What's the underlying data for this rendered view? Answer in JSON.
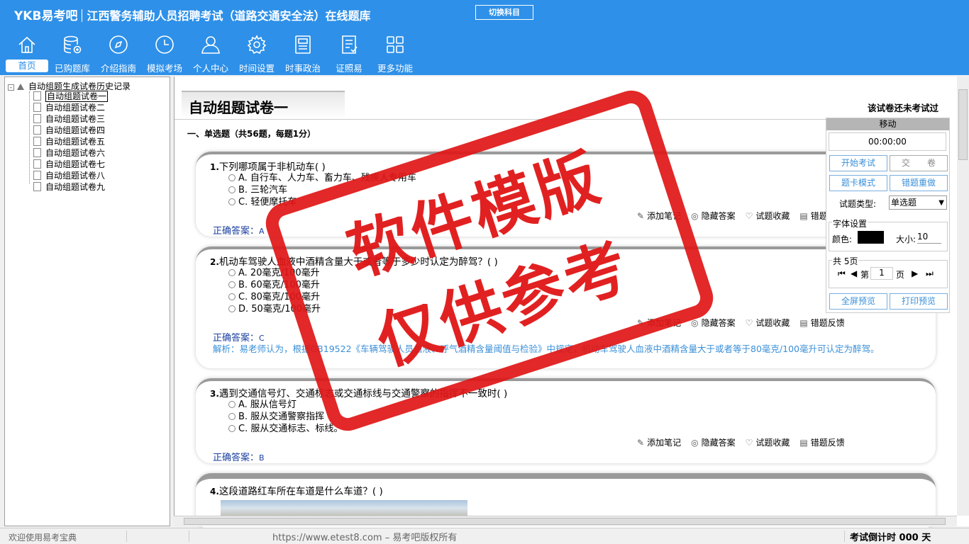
{
  "header": {
    "logo": "YKB易考吧",
    "title": "江西警务辅助人员招聘考试（道路交通安全法）在线题库",
    "switch_label": "切换科目"
  },
  "nav": [
    {
      "label": "首页",
      "icon": "home-icon"
    },
    {
      "label": "已购题库",
      "icon": "database-icon"
    },
    {
      "label": "介绍指南",
      "icon": "compass-icon"
    },
    {
      "label": "模拟考场",
      "icon": "clock-icon"
    },
    {
      "label": "个人中心",
      "icon": "user-icon"
    },
    {
      "label": "时间设置",
      "icon": "gear-icon"
    },
    {
      "label": "时事政治",
      "icon": "newspaper-icon"
    },
    {
      "label": "证照易",
      "icon": "document-icon"
    },
    {
      "label": "更多功能",
      "icon": "grid-icon"
    }
  ],
  "tree": {
    "root": "自动组题生成试卷历史记录",
    "items": [
      "自动组题试卷一",
      "自动组题试卷二",
      "自动组题试卷三",
      "自动组题试卷四",
      "自动组题试卷五",
      "自动组题试卷六",
      "自动组题试卷七",
      "自动组题试卷八",
      "自动组题试卷九"
    ]
  },
  "paper": {
    "title": "自动组题试卷一",
    "status": "该试卷还未考试过",
    "section": "一、单选题（共56题，每题1分）"
  },
  "questions": [
    {
      "num": "1.",
      "text": "下列哪项属于非机动车( )",
      "options": [
        "A. 自行车、人力车、畜力车、残疾人专用车",
        "B. 三轮汽车",
        "C. 轻便摩托车"
      ],
      "answer_label": "正确答案：",
      "answer": "A"
    },
    {
      "num": "2.",
      "text": "机动车驾驶人血液中酒精含量大于或者等于多少时认定为醉驾？( )",
      "options": [
        "A. 20毫克/100毫升",
        "B. 60毫克/100毫升",
        "C. 80毫克/100毫升",
        "D. 50毫克/100毫升"
      ],
      "answer_label": "正确答案：",
      "answer": "C",
      "analysis": "解析：易老师认为，根据GB19522《车辆驾驶人员血液、呼气酒精含量阈值与检验》中规定，机动车驾驶人血液中酒精含量大于或者等于80毫克/100毫升可认定为醉驾。"
    },
    {
      "num": "3.",
      "text": "遇到交通信号灯、交通标志或交通标线与交通警察的指挥不一致时( )",
      "options": [
        "A. 服从信号灯",
        "B. 服从交通警察指挥",
        "C. 服从交通标志、标线。"
      ],
      "answer_label": "正确答案：",
      "answer": "B"
    },
    {
      "num": "4.",
      "text": "这段道路红车所在车道是什么车道？(   )"
    }
  ],
  "actions": {
    "note": "添加笔记",
    "hide": "隐藏答案",
    "fav": "试题收藏",
    "report": "错题反馈"
  },
  "panel": {
    "header": "移动",
    "timer": "00:00:00",
    "start": "开始考试",
    "submit": "交　　卷",
    "card_mode": "题卡模式",
    "redo": "错题重做",
    "type_label": "试题类型:",
    "type_value": "单选题",
    "font_group": "字体设置",
    "color_label": "颜色:",
    "size_label": "大小:",
    "size_value": "10",
    "pages_group": "共 5页",
    "page_prefix": "第",
    "page_value": "1",
    "page_suffix": "页",
    "fullscreen": "全屏预览",
    "print": "打印预览",
    "font_color": "#000000"
  },
  "status": {
    "welcome": "欢迎使用易考宝典",
    "copyright": "https://www.etest8.com – 易考吧版权所有",
    "countdown": "考试倒计时 000 天"
  },
  "watermark": {
    "line1": "软件模版",
    "line2": "仅供参考"
  }
}
